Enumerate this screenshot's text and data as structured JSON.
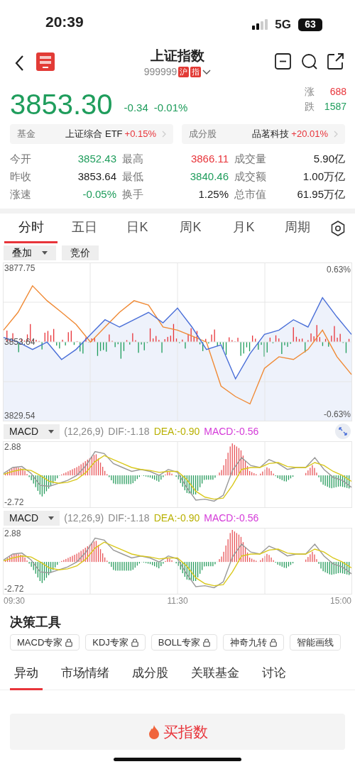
{
  "status_bar": {
    "time": "20:39",
    "network": "5G",
    "battery": "63"
  },
  "header": {
    "title": "上证指数",
    "code": "999999",
    "tags": [
      "沪",
      "指"
    ]
  },
  "quote": {
    "price": "3853.30",
    "change": "-0.34",
    "change_pct": "-0.01%",
    "up_label": "涨",
    "up_count": "688",
    "down_label": "跌",
    "down_count": "1587"
  },
  "related": [
    {
      "label": "基金",
      "name": "上证综合 ETF",
      "change": "+0.15%"
    },
    {
      "label": "成分股",
      "name": "品茗科技",
      "change": "+20.01%"
    }
  ],
  "stats": [
    [
      {
        "label": "今开",
        "value": "3852.43",
        "color": "#1f9d5c"
      },
      {
        "label": "最高",
        "value": "3866.11",
        "color": "#e8343a"
      },
      {
        "label": "成交量",
        "value": "5.90亿",
        "color": "#222222"
      }
    ],
    [
      {
        "label": "昨收",
        "value": "3853.64",
        "color": "#222222"
      },
      {
        "label": "最低",
        "value": "3840.46",
        "color": "#1f9d5c"
      },
      {
        "label": "成交额",
        "value": "1.00万亿",
        "color": "#222222"
      }
    ],
    [
      {
        "label": "涨速",
        "value": "-0.05%",
        "color": "#1f9d5c"
      },
      {
        "label": "换手",
        "value": "1.25%",
        "color": "#222222"
      },
      {
        "label": "总市值",
        "value": "61.95万亿",
        "color": "#222222"
      }
    ]
  ],
  "period_tabs": [
    {
      "label": "分时",
      "selected": true
    },
    {
      "label": "五日",
      "selected": false
    },
    {
      "label": "日K",
      "selected": false
    },
    {
      "label": "周K",
      "selected": false
    },
    {
      "label": "月K",
      "selected": false
    },
    {
      "label": "周期",
      "selected": false
    }
  ],
  "chart_buttons": [
    {
      "label": "叠加",
      "dropdown": true
    },
    {
      "label": "竞价",
      "dropdown": false
    }
  ],
  "intraday": {
    "pct_max": "0.63%",
    "pct_min": "-0.63%",
    "chart_data": {
      "type": "line",
      "grid": true,
      "ylim": [
        3827.69,
        3879.6
      ],
      "yticks": [
        3829.54,
        3853.64,
        3877.75
      ],
      "series": [
        {
          "color": "#4a6fd8",
          "values": [
            3855.1,
            3853.6,
            3851.2,
            3853.6,
            3847.9,
            3851.2,
            3856.1,
            3860.9,
            3858.5,
            3860.9,
            3863.3,
            3859.9,
            3864.7,
            3858.5,
            3851.2,
            3852.7,
            3841.6,
            3849.8,
            3856.1,
            3857.5,
            3860.9,
            3858.5,
            3868.1,
            3861.8,
            3856.1
          ]
        },
        {
          "color": "#f08a35",
          "values": [
            3857.5,
            3863.3,
            3872.0,
            3867.1,
            3863.3,
            3859.4,
            3853.6,
            3858.5,
            3863.3,
            3867.1,
            3865.7,
            3858.5,
            3857.5,
            3855.6,
            3853.6,
            3839.2,
            3835.8,
            3833.4,
            3845.0,
            3848.8,
            3847.9,
            3851.2,
            3857.5,
            3848.8,
            3843.0
          ]
        }
      ]
    }
  },
  "indicators": [
    {
      "name": "MACD",
      "params": "(12,26,9)",
      "dif": "DIF:-1.18",
      "dea": "DEA:-0.90",
      "macd": "MACD:-0.56",
      "expand_button": true,
      "chart_data": {
        "type": "line",
        "grid": true,
        "ylim": [
          -3.29,
          3.45
        ],
        "yticks": [
          -2.72,
          2.88
        ],
        "series": [
          {
            "color": "#999999",
            "values": [
              0.2,
              0.8,
              0.9,
              0.2,
              -1.0,
              -1.1,
              -0.8,
              -0.5,
              0.0,
              1.0,
              2.4,
              2.2,
              1.2,
              0.8,
              0.4,
              0.6,
              0.4,
              0.0,
              0.6,
              0.3,
              -1.2,
              -2.5,
              -2.4,
              -2.6,
              -2.0,
              0.5,
              1.8,
              1.0,
              0.8,
              1.6,
              1.2,
              0.6,
              0.8,
              0.8,
              1.8,
              0.6,
              -0.2,
              -0.5,
              -1.2
            ]
          },
          {
            "color": "#d9c81c",
            "values": [
              0.1,
              0.4,
              0.6,
              0.5,
              0.0,
              -0.6,
              -0.8,
              -0.7,
              -0.4,
              0.3,
              1.4,
              2.0,
              1.6,
              1.2,
              0.8,
              0.6,
              0.5,
              0.3,
              0.4,
              0.4,
              -0.4,
              -1.6,
              -2.2,
              -2.4,
              -2.3,
              -1.0,
              0.6,
              0.8,
              0.8,
              1.2,
              1.3,
              0.9,
              0.8,
              0.8,
              1.3,
              1.0,
              0.4,
              0.0,
              -0.6
            ]
          }
        ]
      }
    },
    {
      "name": "MACD",
      "params": "(12,26,9)",
      "dif": "DIF:-1.18",
      "dea": "DEA:-0.90",
      "macd": "MACD:-0.56",
      "expand_button": false,
      "chart_data": {
        "type": "line",
        "grid": true,
        "ylim": [
          -3.29,
          3.45
        ],
        "yticks": [
          -2.72,
          2.88
        ],
        "series": [
          {
            "color": "#999999",
            "values": [
              0.2,
              0.8,
              0.9,
              0.2,
              -1.0,
              -1.1,
              -0.8,
              -0.5,
              0.0,
              1.0,
              2.4,
              2.2,
              1.2,
              0.8,
              0.4,
              0.6,
              0.4,
              0.0,
              0.6,
              0.3,
              -1.2,
              -2.5,
              -2.4,
              -2.6,
              -2.0,
              0.5,
              1.8,
              1.0,
              0.8,
              1.6,
              1.2,
              0.6,
              0.8,
              0.8,
              1.8,
              0.6,
              -0.2,
              -0.5,
              -1.2
            ]
          },
          {
            "color": "#d9c81c",
            "values": [
              0.1,
              0.4,
              0.6,
              0.5,
              0.0,
              -0.6,
              -0.8,
              -0.7,
              -0.4,
              0.3,
              1.4,
              2.0,
              1.6,
              1.2,
              0.8,
              0.6,
              0.5,
              0.3,
              0.4,
              0.4,
              -0.4,
              -1.6,
              -2.2,
              -2.4,
              -2.3,
              -1.0,
              0.6,
              0.8,
              0.8,
              1.2,
              1.3,
              0.9,
              0.8,
              0.8,
              1.3,
              1.0,
              0.4,
              0.0,
              -0.6
            ]
          }
        ]
      }
    }
  ],
  "time_axis": [
    "09:30",
    "11:30",
    "15:00"
  ],
  "tools": {
    "title": "决策工具",
    "items": [
      {
        "label": "MACD专家",
        "locked": true
      },
      {
        "label": "KDJ专家",
        "locked": true
      },
      {
        "label": "BOLL专家",
        "locked": true
      },
      {
        "label": "神奇九转",
        "locked": true
      },
      {
        "label": "智能画线",
        "locked": false
      }
    ]
  },
  "content_tabs": [
    {
      "label": "异动",
      "selected": true
    },
    {
      "label": "市场情绪",
      "selected": false
    },
    {
      "label": "成分股",
      "selected": false
    },
    {
      "label": "关联基金",
      "selected": false
    },
    {
      "label": "讨论",
      "selected": false
    }
  ],
  "buy_button": {
    "label": "买指数"
  }
}
